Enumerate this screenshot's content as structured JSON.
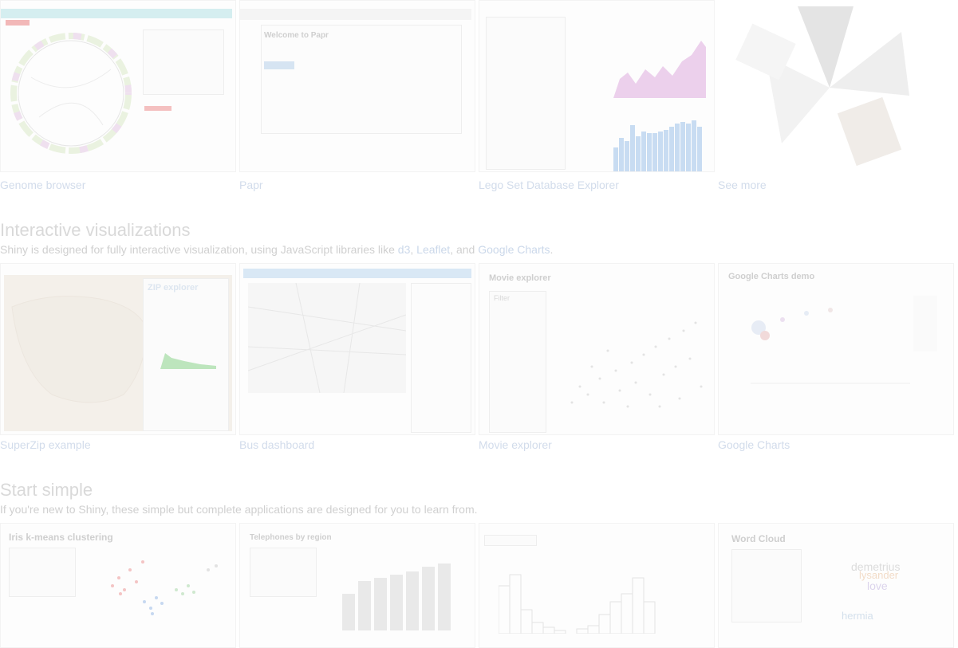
{
  "gallery_top": {
    "cards": [
      {
        "caption": "Genome browser"
      },
      {
        "caption": "Papr"
      },
      {
        "caption": "Lego Set Database Explorer"
      },
      {
        "caption": "See more"
      }
    ],
    "papr": {
      "welcome": "Welcome to Papr"
    }
  },
  "interactive": {
    "heading": "Interactive visualizations",
    "desc_prefix": "Shiny is designed for fully interactive visualization, using JavaScript libraries like ",
    "link_d3": "d3",
    "sep1": ", ",
    "link_leaflet": "Leaflet",
    "sep2": ", and ",
    "link_gcharts": "Google Charts",
    "desc_suffix": ".",
    "cards": [
      {
        "caption": "SuperZip example"
      },
      {
        "caption": "Bus dashboard"
      },
      {
        "caption": "Movie explorer"
      },
      {
        "caption": "Google Charts"
      }
    ],
    "thumb_titles": {
      "superzip": "ZIP explorer",
      "movie": "Movie explorer",
      "gcharts": "Google Charts demo",
      "movie_filter": "Filter"
    }
  },
  "simple": {
    "heading": "Start simple",
    "desc": "If you're new to Shiny, these simple but complete applications are designed for you to learn from.",
    "cards": [
      {
        "title": "Iris k-means clustering"
      },
      {
        "title": "Telephones by region"
      },
      {
        "title": ""
      },
      {
        "title": "Word Cloud"
      }
    ],
    "wordcloud_words": [
      "demetrius",
      "lysander",
      "love",
      "hermia"
    ]
  },
  "colors": {
    "caption_link": "#d2dceb",
    "pink_area": "#ecd0ec",
    "blue_bars": "#c8dcf2",
    "green_area": "#bde5bd"
  }
}
